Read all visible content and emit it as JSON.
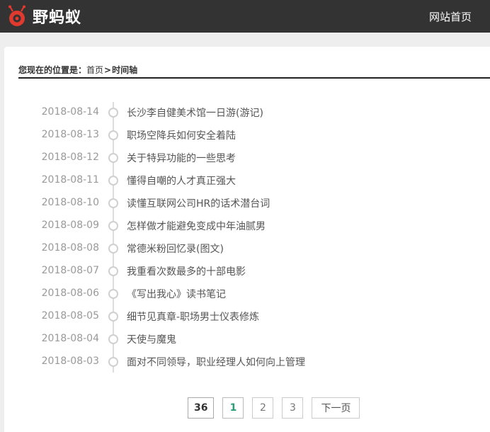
{
  "header": {
    "logo_text": "野蚂蚁",
    "nav_home": "网站首页"
  },
  "breadcrumb": {
    "prefix": "您现在的位置是：",
    "home": "首页",
    "separator": ">",
    "current": "时间轴"
  },
  "timeline": [
    {
      "date": "2018-08-14",
      "title": "长沙李自健美术馆一日游(游记)"
    },
    {
      "date": "2018-08-13",
      "title": "职场空降兵如何安全着陆"
    },
    {
      "date": "2018-08-12",
      "title": "关于特异功能的一些思考"
    },
    {
      "date": "2018-08-11",
      "title": "懂得自嘲的人才真正强大"
    },
    {
      "date": "2018-08-10",
      "title": "读懂互联网公司HR的话术潜台词"
    },
    {
      "date": "2018-08-09",
      "title": "怎样做才能避免变成中年油腻男"
    },
    {
      "date": "2018-08-08",
      "title": "常德米粉回忆录(图文)"
    },
    {
      "date": "2018-08-07",
      "title": "我重看次数最多的十部电影"
    },
    {
      "date": "2018-08-06",
      "title": "《写出我心》读书笔记"
    },
    {
      "date": "2018-08-05",
      "title": "细节见真章-职场男士仪表修炼"
    },
    {
      "date": "2018-08-04",
      "title": "天使与魔鬼"
    },
    {
      "date": "2018-08-03",
      "title": "面对不同领导，职业经理人如何向上管理"
    }
  ],
  "pagination": {
    "total": "36",
    "pages": [
      "1",
      "2",
      "3"
    ],
    "next": "下一页"
  },
  "colors": {
    "header_bg": "#333333",
    "logo_red": "#e03a2f",
    "current_page": "#2a9d78"
  }
}
